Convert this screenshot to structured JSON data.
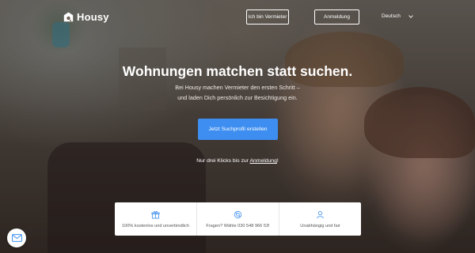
{
  "brand": {
    "name": "Housy"
  },
  "header": {
    "landlord_button": "Ich bin Vermieter",
    "login_button": "Anmeldung",
    "language": "Deutsch"
  },
  "hero": {
    "title": "Wohnungen matchen statt suchen.",
    "subtitle_line1": "Bei Housy machen Vermieter den ersten Schritt –",
    "subtitle_line2": "und laden Dich persönlich zur Besichtigung ein.",
    "cta_label": "Jetzt Suchprofil erstellen",
    "hint_prefix": "Nur drei Klicks bis zur ",
    "hint_link": "Anmeldung",
    "hint_suffix": "!"
  },
  "features": [
    {
      "icon": "gift-icon",
      "text": "100% kostenlos und unverbindlich"
    },
    {
      "icon": "support-icon",
      "text": "Fragen? Wähle 030 548 966 53!"
    },
    {
      "icon": "user-icon",
      "text": "Unabhängig und fair"
    }
  ],
  "colors": {
    "accent": "#3d8ef0",
    "feature_icon": "#3d8ef0",
    "white": "#ffffff"
  },
  "chat": {
    "icon": "mail-icon"
  }
}
